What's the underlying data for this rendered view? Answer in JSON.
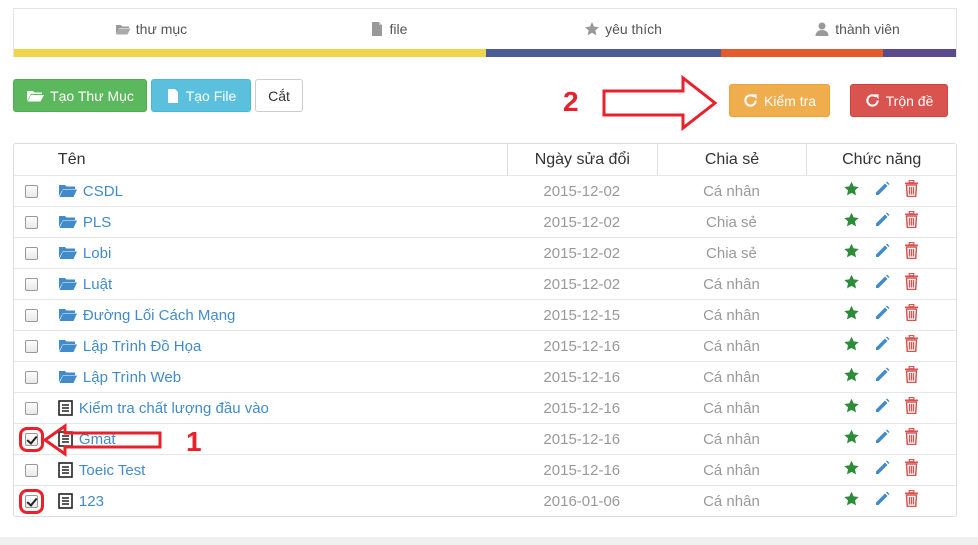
{
  "nav": {
    "tabs": [
      {
        "label": "thư mục",
        "icon": "folder-open-icon"
      },
      {
        "label": "file",
        "icon": "file-icon"
      },
      {
        "label": "yêu thích",
        "icon": "star-icon"
      },
      {
        "label": "thành viên",
        "icon": "user-icon"
      }
    ],
    "bar_colors": [
      "#efd54a",
      "#4a5b96",
      "#e55a2b",
      "#5b4a8c"
    ]
  },
  "toolbar": {
    "new_folder": "Tạo Thư Mục",
    "new_file": "Tạo File",
    "cut": "Cắt",
    "check": "Kiểm tra",
    "mix": "Trộn đề"
  },
  "table": {
    "headers": {
      "name": "Tên",
      "date": "Ngày sửa đổi",
      "share": "Chia sẻ",
      "actions": "Chức năng"
    },
    "rows": [
      {
        "type": "folder",
        "name": "CSDL",
        "date": "2015-12-02",
        "share": "Cá nhân",
        "checked": false
      },
      {
        "type": "folder",
        "name": "PLS",
        "date": "2015-12-02",
        "share": "Chia sẻ",
        "checked": false
      },
      {
        "type": "folder",
        "name": "Lobi",
        "date": "2015-12-02",
        "share": "Chia sẻ",
        "checked": false
      },
      {
        "type": "folder",
        "name": "Luật",
        "date": "2015-12-02",
        "share": "Cá nhân",
        "checked": false
      },
      {
        "type": "folder",
        "name": "Đường Lối Cách Mạng",
        "date": "2015-12-15",
        "share": "Cá nhân",
        "checked": false
      },
      {
        "type": "folder",
        "name": "Lập Trình Đồ Họa",
        "date": "2015-12-16",
        "share": "Cá nhân",
        "checked": false
      },
      {
        "type": "folder",
        "name": "Lập Trình Web",
        "date": "2015-12-16",
        "share": "Cá nhân",
        "checked": false
      },
      {
        "type": "file",
        "name": "Kiểm tra chất lượng đầu vào",
        "date": "2015-12-16",
        "share": "Cá nhân",
        "checked": false
      },
      {
        "type": "file",
        "name": "Gmat",
        "date": "2015-12-16",
        "share": "Cá nhân",
        "checked": true
      },
      {
        "type": "file",
        "name": "Toeic Test",
        "date": "2015-12-16",
        "share": "Cá nhân",
        "checked": false
      },
      {
        "type": "file",
        "name": "123",
        "date": "2016-01-06",
        "share": "Cá nhân",
        "checked": true
      }
    ]
  },
  "annotations": {
    "step1": "1",
    "step2": "2",
    "color": "#e8212b"
  }
}
